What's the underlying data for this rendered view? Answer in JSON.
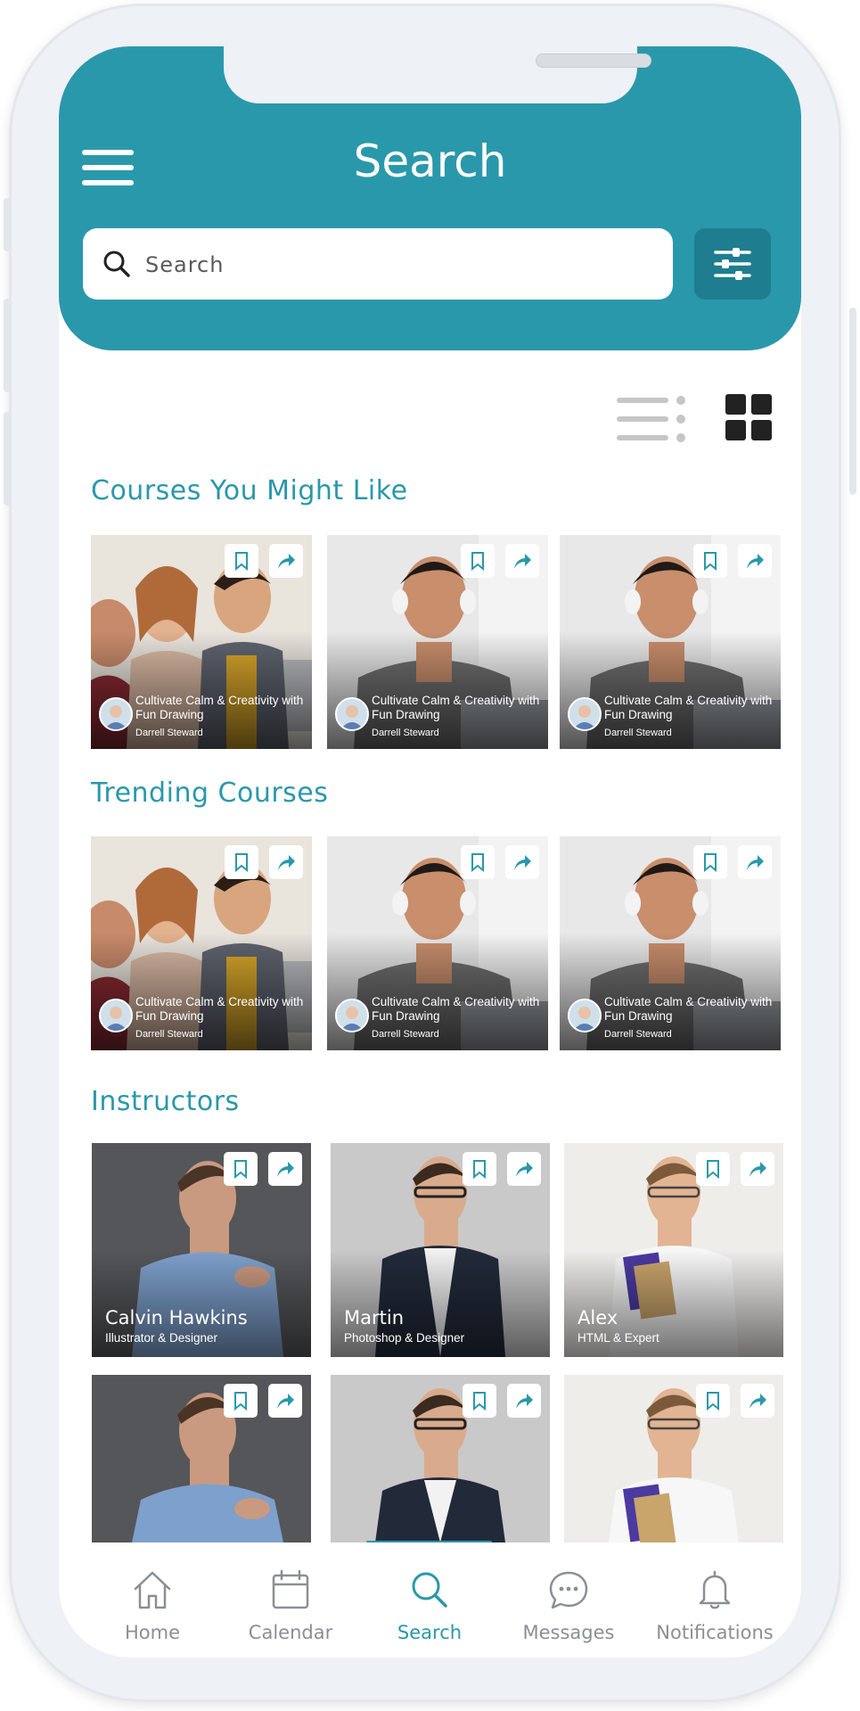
{
  "header": {
    "title": "Search"
  },
  "search": {
    "placeholder": "Search"
  },
  "colors": {
    "accent": "#2a98ab",
    "accent_dark": "#1e7e8f",
    "tab_inactive": "#8a8f96"
  },
  "sections": {
    "courses": {
      "title": "Courses You Might Like",
      "cards": [
        {
          "title": "Cultivate Calm & Creativity with Fun Drawing",
          "author": "Darrell Steward"
        },
        {
          "title": "Cultivate Calm & Creativity with Fun Drawing",
          "author": "Darrell Steward"
        },
        {
          "title": "Cultivate Calm & Creativity with Fun Drawing",
          "author": "Darrell Steward"
        }
      ]
    },
    "trending": {
      "title": "Trending Courses",
      "cards": [
        {
          "title": "Cultivate Calm & Creativity with Fun Drawing",
          "author": "Darrell Steward"
        },
        {
          "title": "Cultivate Calm & Creativity with Fun Drawing",
          "author": "Darrell Steward"
        },
        {
          "title": "Cultivate Calm & Creativity with Fun Drawing",
          "author": "Darrell Steward"
        }
      ]
    },
    "instructors": {
      "title": "Instructors",
      "cards": [
        {
          "name": "Calvin Hawkins",
          "role": "Illustrator & Designer"
        },
        {
          "name": "Martin",
          "role": "Photoshop & Designer"
        },
        {
          "name": "Alex",
          "role": "HTML & Expert"
        }
      ]
    }
  },
  "tabs": [
    {
      "label": "Home",
      "icon": "home-icon"
    },
    {
      "label": "Calendar",
      "icon": "calendar-icon"
    },
    {
      "label": "Search",
      "icon": "search-icon"
    },
    {
      "label": "Messages",
      "icon": "chat-icon"
    },
    {
      "label": "Notifications",
      "icon": "bell-icon"
    }
  ]
}
